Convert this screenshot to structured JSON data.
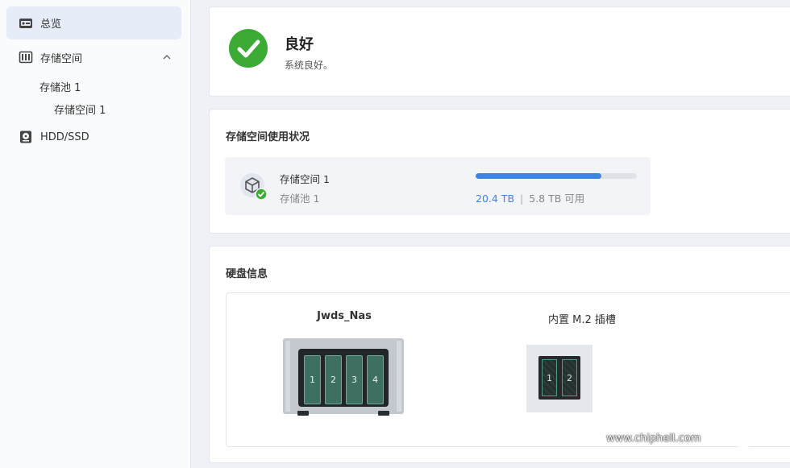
{
  "sidebar": {
    "items": [
      {
        "label": "总览",
        "icon": "overview-icon"
      },
      {
        "label": "存储空间",
        "icon": "storage-icon"
      },
      {
        "label": "存储池 1"
      },
      {
        "label": "存储空间 1"
      },
      {
        "label": "HDD/SSD",
        "icon": "hdd-icon"
      }
    ]
  },
  "status": {
    "title": "良好",
    "subtitle": "系统良好。",
    "color": "#3bab35"
  },
  "usage": {
    "title": "存储空间使用状况",
    "volume_name": "存储空间 1",
    "pool_name": "存储池 1",
    "used": "20.4 TB",
    "separator": "|",
    "available": "5.8 TB 可用",
    "used_fraction": 0.78,
    "accent": "#3d85e0"
  },
  "disks": {
    "title": "硬盘信息",
    "nas_name": "Jwds_Nas",
    "nas_bays": [
      "1",
      "2",
      "3",
      "4"
    ],
    "m2_title": "内置 M.2 插槽",
    "m2_slots": [
      "1",
      "2"
    ]
  },
  "watermark": {
    "url": "www.chiphell.com",
    "logo": "chip hell"
  }
}
